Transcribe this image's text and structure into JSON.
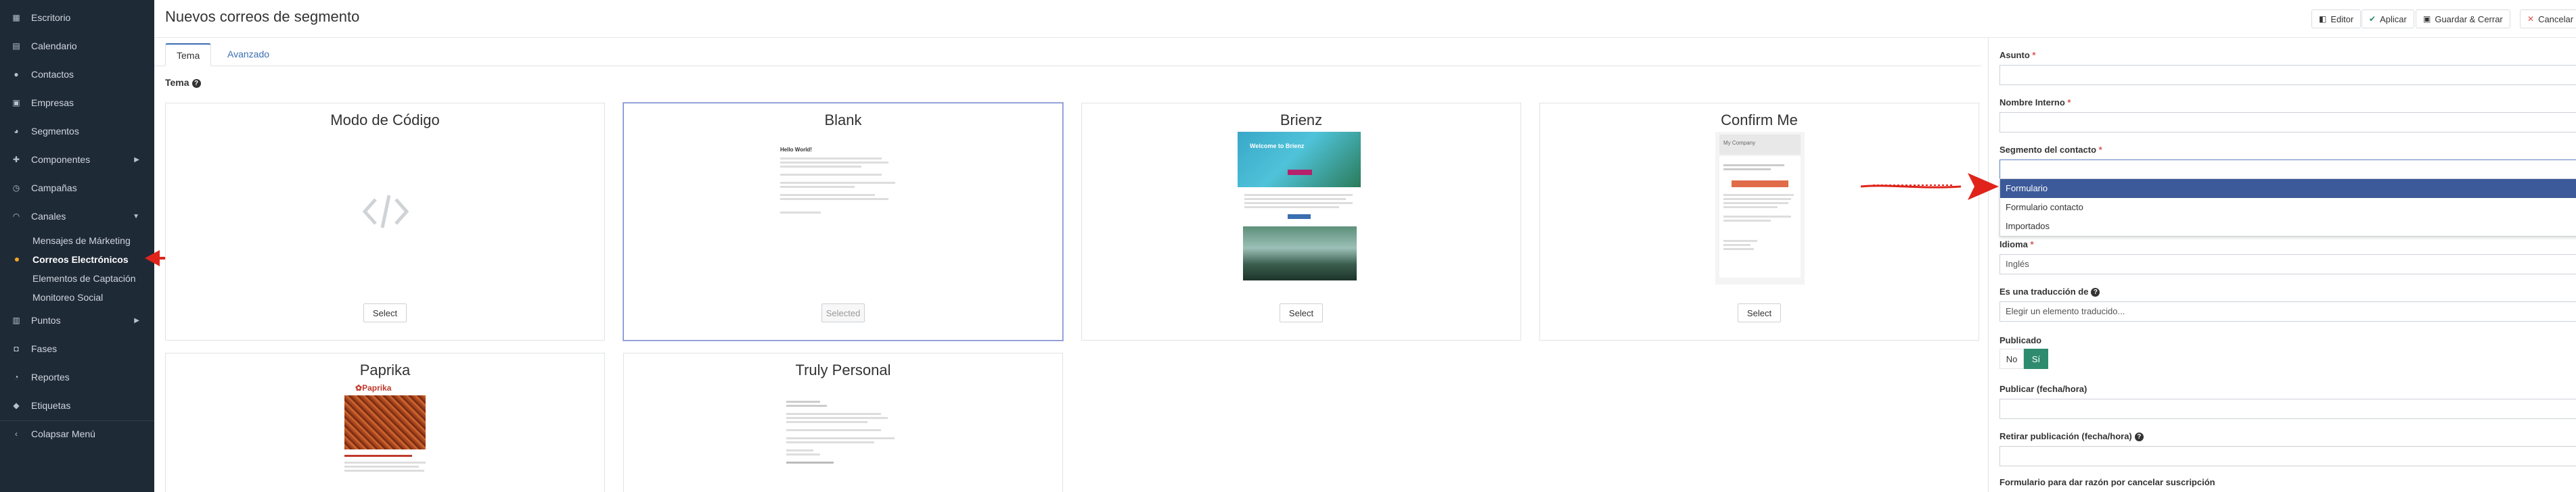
{
  "sidebar": {
    "items": [
      {
        "label": "Escritorio",
        "icon": "dashboard-icon"
      },
      {
        "label": "Calendario",
        "icon": "calendar-icon"
      },
      {
        "label": "Contactos",
        "icon": "user-icon"
      },
      {
        "label": "Empresas",
        "icon": "building-icon"
      },
      {
        "label": "Segmentos",
        "icon": "pie-chart-icon"
      },
      {
        "label": "Componentes",
        "icon": "puzzle-icon"
      },
      {
        "label": "Campañas",
        "icon": "clock-icon"
      },
      {
        "label": "Canales",
        "icon": "rss-icon"
      },
      {
        "label": "Puntos",
        "icon": "calculator-icon"
      },
      {
        "label": "Fases",
        "icon": "car-icon"
      },
      {
        "label": "Reportes",
        "icon": "line-chart-icon"
      },
      {
        "label": "Etiquetas",
        "icon": "tag-icon"
      }
    ],
    "sub_items": [
      {
        "label": "Mensajes de Márketing"
      },
      {
        "label": "Correos Electrónicos"
      },
      {
        "label": "Elementos de Captación"
      },
      {
        "label": "Monitoreo Social"
      }
    ],
    "collapse_label": "Colapsar Menú"
  },
  "header": {
    "title": "Nuevos correos de segmento",
    "buttons": {
      "editor": "Editor",
      "apply": "Aplicar",
      "save_close": "Guardar & Cerrar",
      "cancel": "Cancelar"
    }
  },
  "tabs": [
    {
      "label": "Tema"
    },
    {
      "label": "Avanzado"
    }
  ],
  "theme_section_label": "Tema",
  "themes": [
    {
      "title": "Modo de Código",
      "button": "Select"
    },
    {
      "title": "Blank",
      "button": "Selected"
    },
    {
      "title": "Brienz",
      "button": "Select"
    },
    {
      "title": "Confirm Me",
      "button": "Select"
    },
    {
      "title": "Paprika",
      "button": ""
    },
    {
      "title": "Truly Personal",
      "button": ""
    }
  ],
  "thumbnails": {
    "blank_heading": "Hello World!",
    "brienz_headline": "Welcome to Brienz",
    "confirm_company": "My Company",
    "paprika_logo": "Paprika"
  },
  "form": {
    "subject_label": "Asunto",
    "internal_name_label": "Nombre Interno",
    "segment_label": "Segmento del contacto",
    "segment_options": [
      "Formulario",
      "Formulario contacto",
      "Importados"
    ],
    "language_label": "Idioma",
    "language_value": "Inglés",
    "translation_label": "Es una traducción de",
    "translation_placeholder": "Elegir un elemento traducido...",
    "published_label": "Publicado",
    "published_no": "No",
    "published_yes": "Sí",
    "publish_at_label": "Publicar (fecha/hora)",
    "unpublish_at_label": "Retirar publicación (fecha/hora)",
    "unsubscribe_form_label": "Formulario para dar razón por cancelar suscripción"
  },
  "colors": {
    "sidebar_bg": "#1f2a37",
    "accent_blue": "#3a6fb0",
    "highlight": "#3c5a99",
    "published_green": "#2e8b6e",
    "annotation_red": "#e0241b"
  }
}
